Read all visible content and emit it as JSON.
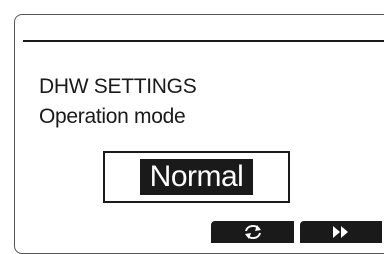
{
  "screen": {
    "title": "DHW SETTINGS",
    "subtitle": "Operation mode"
  },
  "mode_selector": {
    "value": "Normal"
  },
  "softkeys": [
    {
      "icon": "refresh-icon"
    },
    {
      "icon": "fast-forward-icon"
    }
  ],
  "colors": {
    "foreground": "#1a1a1a",
    "background": "#ffffff"
  }
}
